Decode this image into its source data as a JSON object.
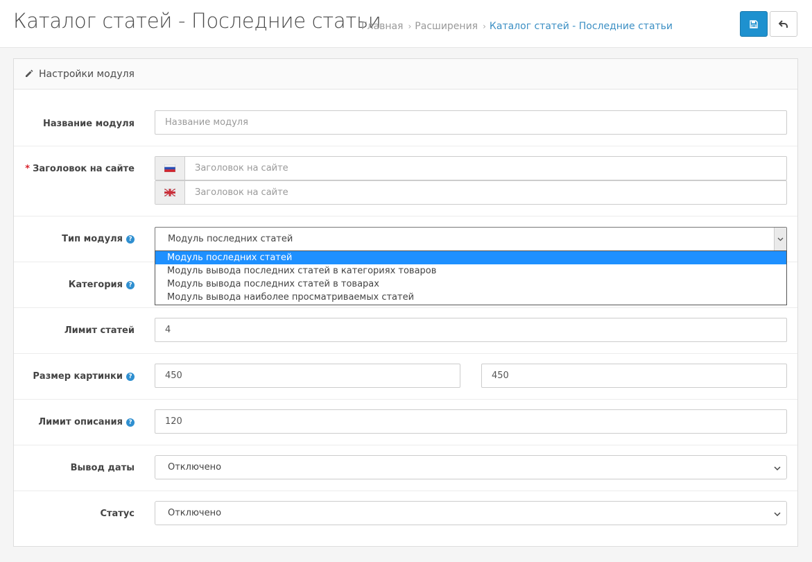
{
  "header": {
    "title": "Каталог статей - Последние статьи",
    "breadcrumb": [
      "Главная",
      "Расширения",
      "Каталог статей - Последние статьи"
    ]
  },
  "icons": {
    "save": "save-icon",
    "back": "reply-icon",
    "pencil": "pencil-icon"
  },
  "colors": {
    "primary": "#1e91cf",
    "link": "#3b8fc4",
    "help": "#2f8fd0",
    "required": "#d9232d",
    "selected_option": "#1e90ff"
  },
  "panel": {
    "title": "Настройки модуля"
  },
  "form": {
    "name": {
      "label": "Название модуля",
      "placeholder": "Название модуля"
    },
    "heading": {
      "required_mark": "*",
      "label": "Заголовок на сайте",
      "placeholder_ru": "Заголовок на сайте",
      "placeholder_en": "Заголовок на сайте"
    },
    "module_type": {
      "label": "Тип модуля",
      "value": "Модуль последних статей",
      "options": [
        "Модуль последних статей",
        "Модуль вывода последних статей в категориях товаров",
        "Модуль вывода последних статей в товарах",
        "Модуль вывода наиболее просматриваемых статей"
      ]
    },
    "category": {
      "label": "Категория"
    },
    "limit": {
      "label": "Лимит статей",
      "value": "4"
    },
    "image_size": {
      "label": "Размер картинки",
      "width": "450",
      "height": "450"
    },
    "desc_limit": {
      "label": "Лимит описания",
      "value": "120"
    },
    "date_output": {
      "label": "Вывод даты",
      "value": "Отключено"
    },
    "status": {
      "label": "Статус",
      "value": "Отключено"
    }
  }
}
